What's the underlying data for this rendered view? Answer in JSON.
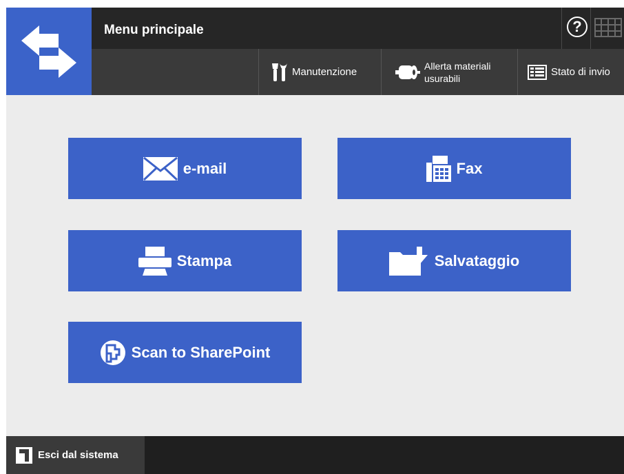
{
  "header": {
    "title": "Menu principale",
    "home_icon": "arrows-exchange-icon",
    "help_icon": "help-icon",
    "help_label": "?",
    "keyboard_icon": "keyboard-icon"
  },
  "toolbar": {
    "maintenance_label": "Manutenzione",
    "consumables_label_line1": "Allerta materiali",
    "consumables_label_line2": "usurabili",
    "status_label": "Stato di invio"
  },
  "tiles": {
    "email": "e-mail",
    "fax": "Fax",
    "print": "Stampa",
    "save": "Salvataggio",
    "sharepoint": "Scan to SharePoint"
  },
  "footer": {
    "logout_label": "Esci dal sistema"
  },
  "colors": {
    "accent_blue": "#3c62c8",
    "header_dark": "#262626",
    "toolbar_gray": "#3a3a3a",
    "background": "#ececec"
  }
}
